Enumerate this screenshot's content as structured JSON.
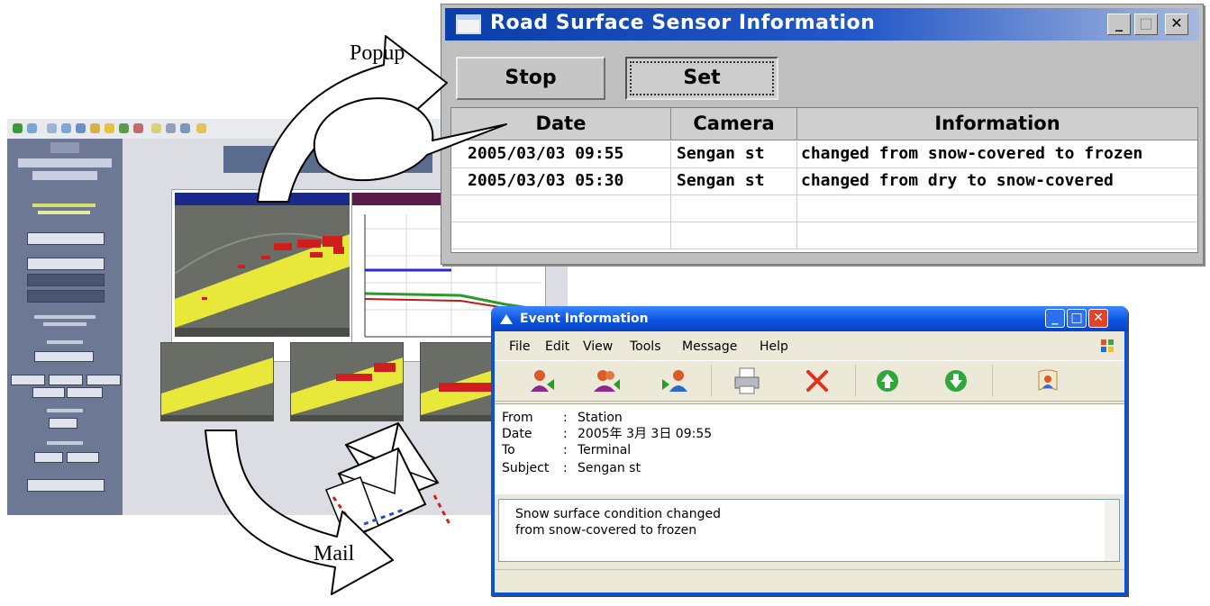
{
  "popup": {
    "title": "Road Surface Sensor Information",
    "controls": {
      "minimize": "_",
      "maximize": "□",
      "close": "✕"
    },
    "buttons": {
      "stop": "Stop",
      "set": "Set"
    },
    "columns": [
      "Date",
      "Camera",
      "Information"
    ],
    "rows": [
      {
        "date": "2005/03/03 09:55",
        "camera": "Sengan st",
        "information": "changed from snow-covered to frozen"
      },
      {
        "date": "2005/03/03 05:30",
        "camera": "Sengan st",
        "information": "changed from dry to snow-covered"
      },
      {
        "date": "",
        "camera": "",
        "information": ""
      },
      {
        "date": "",
        "camera": "",
        "information": ""
      }
    ]
  },
  "mail": {
    "title": "Event Information",
    "menu": [
      "File",
      "Edit",
      "View",
      "Tools",
      "Message",
      "Help"
    ],
    "toolbar_icons": [
      "reply-icon",
      "reply-all-icon",
      "forward-icon",
      "print-icon",
      "delete-icon",
      "previous-icon",
      "next-icon",
      "address-book-icon"
    ],
    "headers": {
      "from_label": "From",
      "from": "Station",
      "date_label": "Date",
      "date": "2005年 3月 3日 09:55",
      "to_label": "To",
      "to": "Terminal",
      "subject_label": "Subject",
      "subject": "Sengan st"
    },
    "colon": ":",
    "message": {
      "line1": "Snow surface condition changed",
      "line2": "from snow-covered to frozen"
    }
  },
  "annotations": {
    "popup_label": "Popup",
    "mail_label": "Mail"
  },
  "colors": {
    "popup_title_bar": "#0a3ea8",
    "mail_title_bar": "#0a55e0",
    "road_surface": "#e8e83a",
    "alert_red": "#d01e1e"
  }
}
